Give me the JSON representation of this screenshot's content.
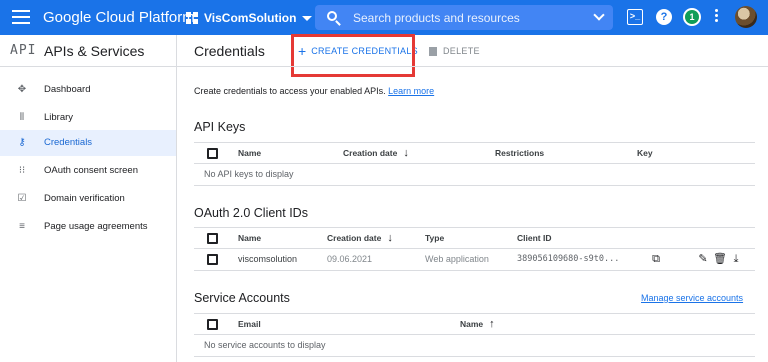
{
  "topbar": {
    "brand": "Google Cloud Platform",
    "project_name": "VisComSolution",
    "search_placeholder": "Search products and resources",
    "notification_count": "1",
    "help_glyph": "?",
    "terminal_glyph": ">_",
    "icons": [
      "menu-icon",
      "project-icon",
      "search-icon",
      "terminal-icon",
      "help-icon",
      "notification-icon",
      "more-vert-icon",
      "avatar"
    ],
    "bar_color": "#1a73e8"
  },
  "sidebar": {
    "logo": "API",
    "title": "APIs & Services",
    "items": [
      {
        "label": "Dashboard",
        "icon": "dashboard-icon",
        "glyph": "✥",
        "active": false
      },
      {
        "label": "Library",
        "icon": "library-icon",
        "glyph": "⦀",
        "active": false
      },
      {
        "label": "Credentials",
        "icon": "key-icon",
        "glyph": "⚷",
        "active": true
      },
      {
        "label": "OAuth consent screen",
        "icon": "consent-icon",
        "glyph": "⁝⁝",
        "active": false
      },
      {
        "label": "Domain verification",
        "icon": "domain-icon",
        "glyph": "☑",
        "active": false
      },
      {
        "label": "Page usage agreements",
        "icon": "settings-list-icon",
        "glyph": "≡",
        "active": false
      }
    ]
  },
  "main": {
    "title": "Credentials",
    "create_label": "CREATE CREDENTIALS",
    "delete_label": "DELETE",
    "intro_text": "Create credentials to access your enabled APIs.",
    "learn_more": "Learn more",
    "highlight_color": "#e53935"
  },
  "api_keys": {
    "title": "API Keys",
    "columns": [
      "Name",
      "Creation date",
      "Restrictions",
      "Key"
    ],
    "empty_text": "No API keys to display"
  },
  "oauth": {
    "title": "OAuth 2.0 Client IDs",
    "columns": [
      "Name",
      "Creation date",
      "Type",
      "Client ID"
    ],
    "rows": [
      {
        "name": "viscomsolution",
        "date": "09.06.2021",
        "type": "Web application",
        "client_id": "389056109680-s9t0..."
      }
    ]
  },
  "service_accounts": {
    "title": "Service Accounts",
    "manage_link": "Manage service accounts",
    "columns": [
      "Email",
      "Name"
    ],
    "empty_text": "No service accounts to display"
  }
}
